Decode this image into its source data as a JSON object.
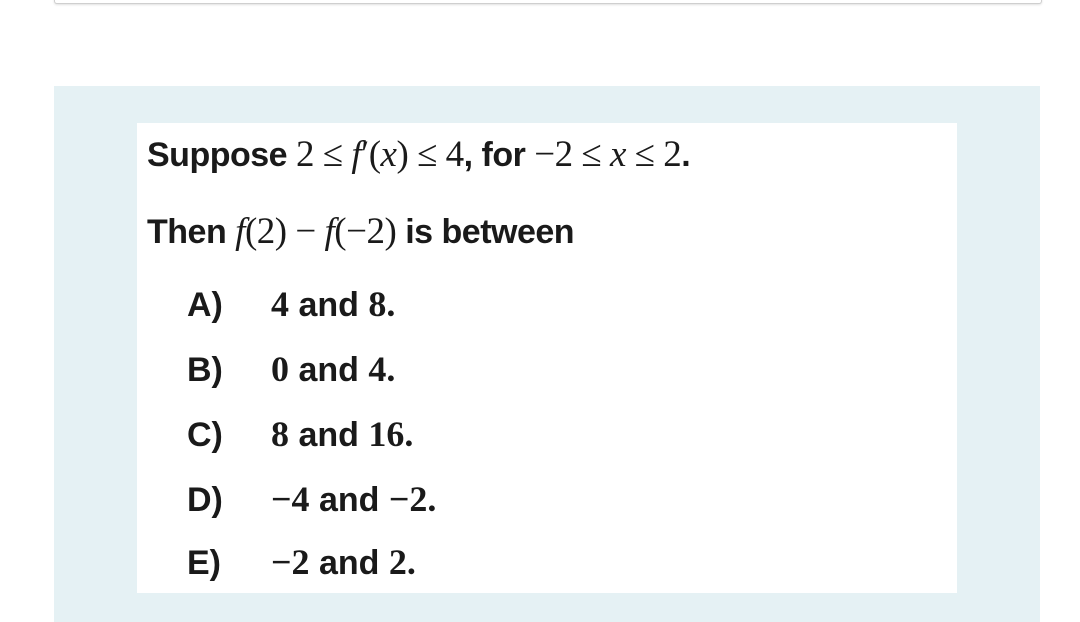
{
  "question": {
    "line1": {
      "prefix": "Suppose ",
      "math1": "2 ≤ ",
      "func": "f",
      "prime": "′",
      "arg_open": "(",
      "var": "x",
      "arg_close": ")",
      "math2": " ≤ 4",
      "comma_for": ", for ",
      "math3": "−2 ≤ ",
      "var2": "x",
      "math4": " ≤ 2",
      "suffix": "."
    },
    "line2": {
      "prefix": "Then ",
      "func1": "f",
      "arg1": "(2) − ",
      "func2": "f",
      "arg2": "(−2)",
      "suffix": " is between"
    }
  },
  "options": [
    {
      "letter": "A)",
      "num1": "4",
      "and": " and ",
      "num2": "8."
    },
    {
      "letter": "B)",
      "num1": "0",
      "and": " and ",
      "num2": "4."
    },
    {
      "letter": "C)",
      "num1": "8",
      "and": " and ",
      "num2": "16."
    },
    {
      "letter": "D)",
      "num1": "−4",
      "and": " and ",
      "num2": "−2."
    },
    {
      "letter": "E)",
      "num1": "−2",
      "and": " and ",
      "num2": "2."
    }
  ],
  "colors": {
    "panel_background": "#e5f1f4",
    "card_background": "#ffffff",
    "text": "#1a1a1a"
  }
}
